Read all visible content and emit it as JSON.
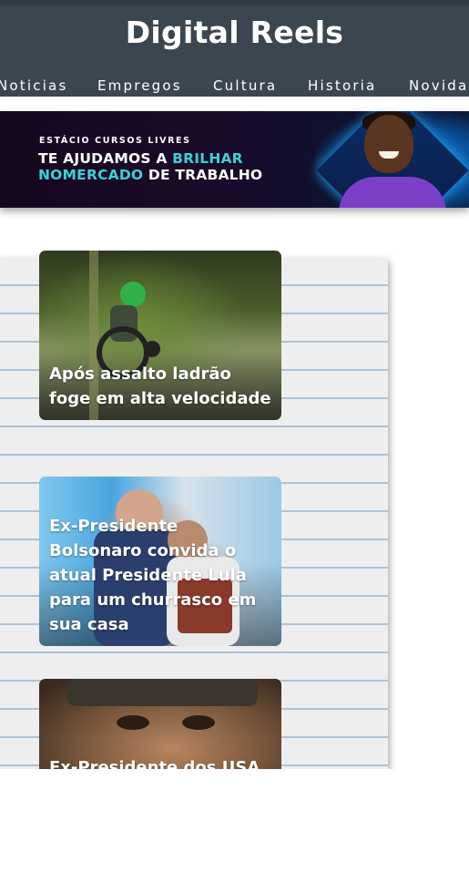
{
  "header": {
    "site_title": "Digital Reels",
    "nav": [
      "Noticias",
      "Empregos",
      "Cultura",
      "Historia",
      "Novida"
    ]
  },
  "banner": {
    "kicker": "ESTÁCIO CURSOS LIVRES",
    "line1_a": "TE AJUDAMOS A ",
    "line1_b": "BRILHAR",
    "line2_a": "NOMERCADO",
    "line2_b": " DE TRABALHO"
  },
  "articles": [
    {
      "title": "Após assalto ladrão foge em alta velocidade"
    },
    {
      "title": "Ex-Presidente Bolsonaro convida o atual Presidente Lula para um churrasco em sua casa"
    },
    {
      "title": "Ex-Presidente dos USA"
    }
  ],
  "colors": {
    "header_bg": "#3c4651",
    "banner_accent": "#3dd0d8"
  }
}
